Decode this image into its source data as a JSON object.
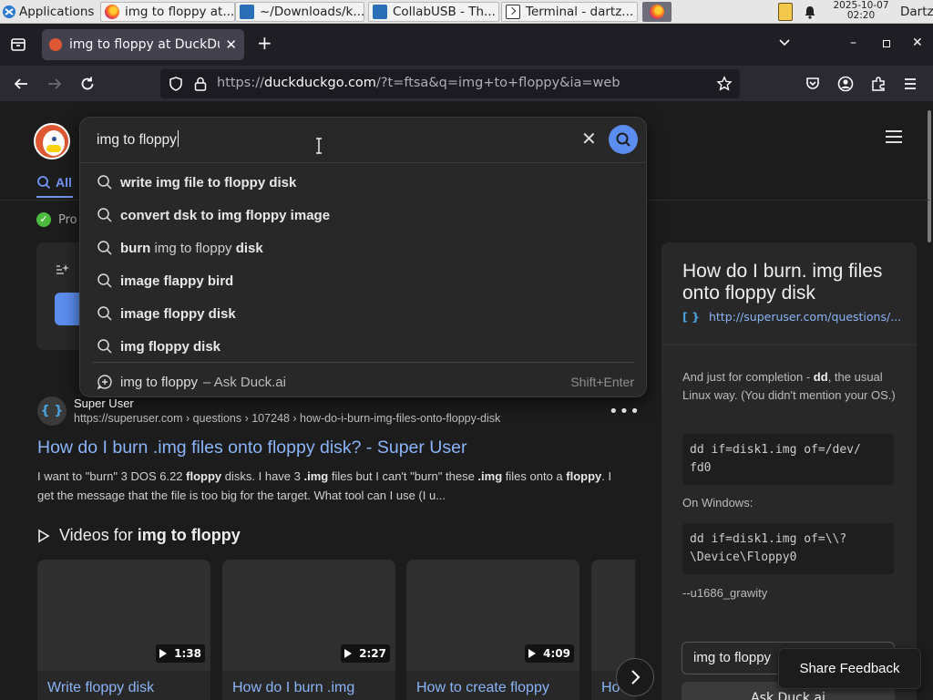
{
  "taskbar": {
    "apps_label": "Applications",
    "windows": [
      {
        "title": "img to floppy at..."
      },
      {
        "title": "~/Downloads/k..."
      },
      {
        "title": "CollabUSB - Th..."
      },
      {
        "title": "Terminal - dartz..."
      }
    ],
    "clock_date": "2025-10-07",
    "clock_time": "02:20",
    "user": "Dartz"
  },
  "browser": {
    "tab_title": "img to floppy at DuckDuckGo",
    "url_domain": "duckduckgo.com",
    "url_prefix": "https://",
    "url_rest": "/?t=ftsa&q=img+to+floppy&ia=web"
  },
  "search": {
    "query": "img to floppy",
    "suggestions": [
      {
        "parts": [
          {
            "t": "write img file to floppy disk",
            "b": true
          }
        ]
      },
      {
        "parts": [
          {
            "t": "convert dsk to img floppy image",
            "b": true
          }
        ]
      },
      {
        "parts": [
          {
            "t": "burn",
            "b": true
          },
          {
            "t": " img to floppy ",
            "b": false
          },
          {
            "t": "disk",
            "b": true
          }
        ]
      },
      {
        "parts": [
          {
            "t": "image flappy bird",
            "b": true
          }
        ]
      },
      {
        "parts": [
          {
            "t": "image floppy disk",
            "b": true
          }
        ]
      },
      {
        "parts": [
          {
            "t": "img floppy disk",
            "b": true
          }
        ]
      }
    ],
    "ask_query": "img to floppy",
    "ask_suffix": "– Ask Duck.ai",
    "ask_shortcut": "Shift+Enter"
  },
  "page": {
    "tab_all": "All",
    "protected_label": "Pro"
  },
  "result": {
    "site": "Super User",
    "url": "https://superuser.com › questions › 107248 › how-do-i-burn-img-files-onto-floppy-disk",
    "title": "How do I burn .img files onto floppy disk? - Super User",
    "snippet_parts": [
      {
        "t": "I want to \"burn\" 3 DOS 6.22 ",
        "b": false
      },
      {
        "t": "floppy",
        "b": true
      },
      {
        "t": " disks. I have 3 ",
        "b": false
      },
      {
        "t": ".img",
        "b": true
      },
      {
        "t": " files but I can't \"burn\" these ",
        "b": false
      },
      {
        "t": ".img",
        "b": true
      },
      {
        "t": " files onto a ",
        "b": false
      },
      {
        "t": "floppy",
        "b": true
      },
      {
        "t": ". I get the message that the file is too big for the target. What tool can I use (I u...",
        "b": false
      }
    ]
  },
  "videos": {
    "heading_prefix": "Videos for ",
    "heading_query": "img to floppy",
    "items": [
      {
        "duration": "1:38",
        "title": "Write floppy disk"
      },
      {
        "duration": "2:27",
        "title": "How do I burn .img"
      },
      {
        "duration": "4:09",
        "title": "How to create floppy"
      },
      {
        "duration": "",
        "title": "Ho"
      }
    ]
  },
  "side_panel": {
    "title": "How do I burn. img files onto floppy disk",
    "source_link": "http://superuser.com/questions/...",
    "intro_prefix": "And just for completion - ",
    "intro_bold": "dd",
    "intro_suffix": ", the usual Linux way. (You didn't mention your OS.)",
    "code_linux": "dd if=disk1.img of=/dev/\nfd0",
    "windows_label": "On Windows:",
    "code_windows": "dd if=disk1.img of=\\\\?\n\\Device\\Floppy0",
    "author": "--u1686_grawity",
    "ask_input_value": "img to floppy",
    "ask_button": "Ask Duck.ai"
  },
  "feedback_button": "Share Feedback"
}
